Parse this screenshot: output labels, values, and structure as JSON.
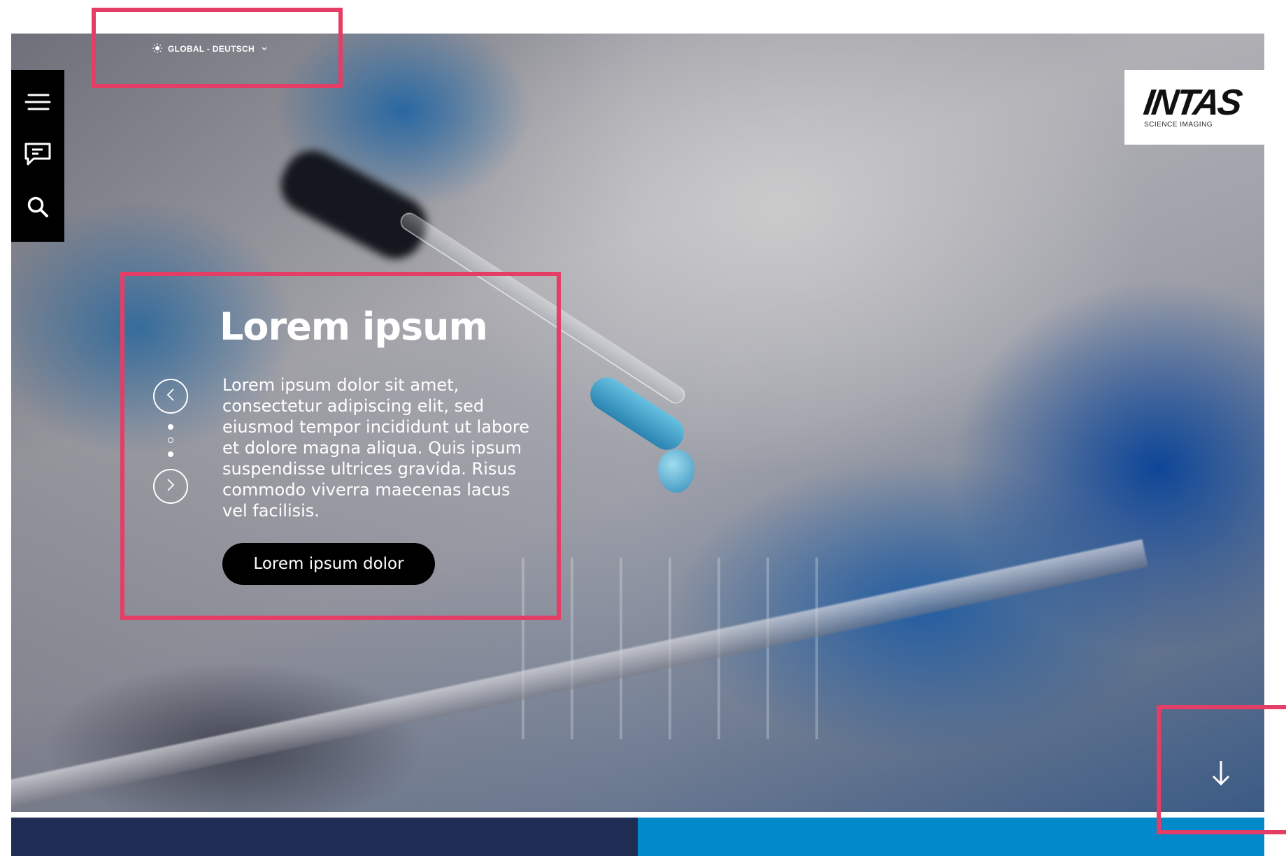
{
  "language": {
    "label": "GLOBAL - DEUTSCH",
    "icon": "sun-icon",
    "chevron_icon": "chevron-down-icon"
  },
  "toolbar": {
    "items": [
      {
        "name": "menu",
        "icon": "hamburger-menu-icon"
      },
      {
        "name": "chat",
        "icon": "chat-bubble-icon"
      },
      {
        "name": "search",
        "icon": "search-icon"
      }
    ]
  },
  "logo": {
    "wordmark": "INTAS",
    "tagline": "SCIENCE IMAGING"
  },
  "slider": {
    "title": "Lorem ipsum",
    "body": "Lorem ipsum dolor sit amet, consectetur adipiscing elit, sed eiusmod tempor incididunt ut labore et dolore magna aliqua. Quis ipsum suspendisse ultrices gravida. Risus commodo viverra maecenas lacus vel facilisis.",
    "cta_label": "Lorem ipsum dolor",
    "prev_icon": "chevron-left-icon",
    "next_icon": "chevron-right-icon",
    "slide_count": 3,
    "active_slide": 2
  },
  "scroll": {
    "icon": "arrow-down-icon"
  },
  "colors": {
    "annotation": "#e43e66",
    "bar_dark": "#1f2d55",
    "bar_light": "#0289c9",
    "toolbar_bg": "#000000"
  }
}
